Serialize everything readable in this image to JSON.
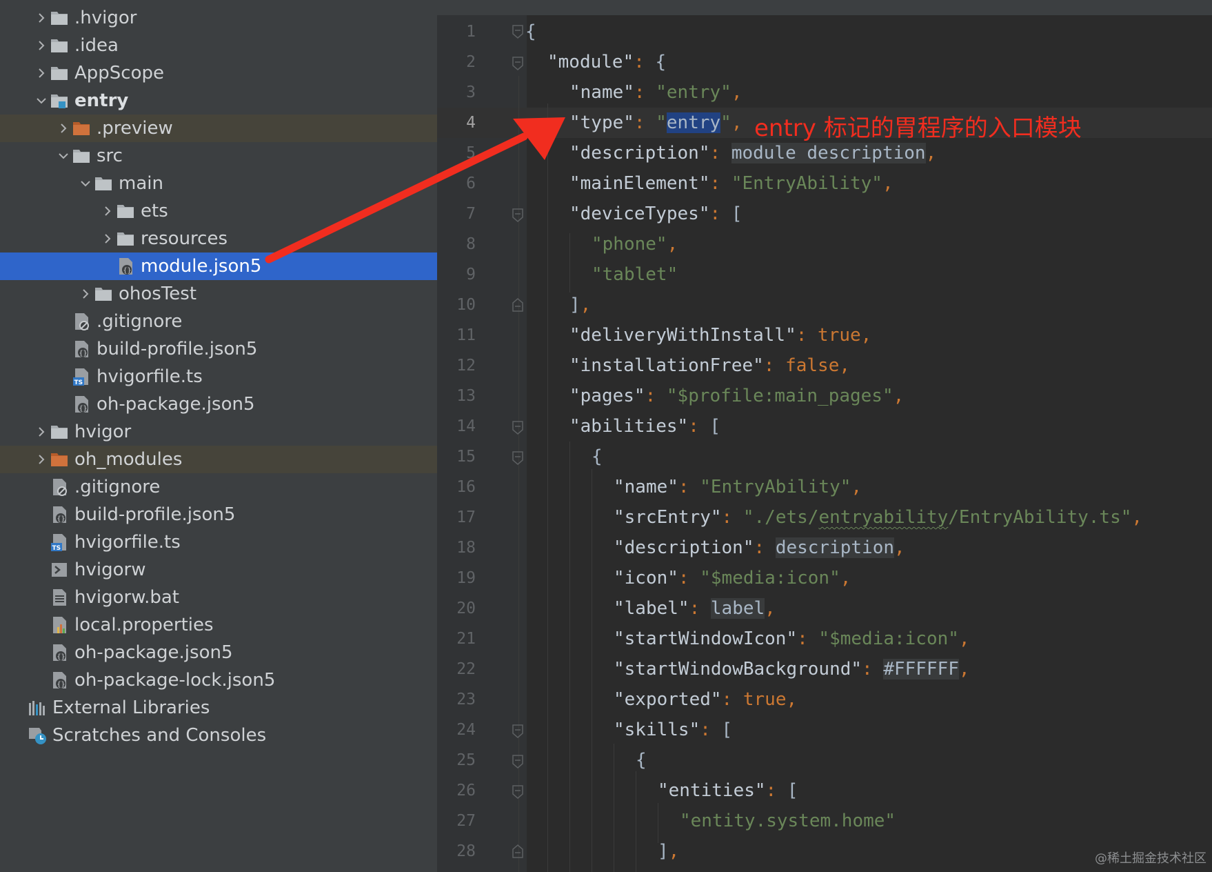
{
  "project_tree": {
    "items": [
      {
        "label": ".hvigor",
        "expanded": false,
        "icon": "folder-icon"
      },
      {
        "label": ".idea",
        "expanded": false,
        "icon": "folder-icon"
      },
      {
        "label": "AppScope",
        "expanded": false,
        "icon": "folder-icon"
      },
      {
        "label": "entry",
        "expanded": true,
        "icon": "module-folder-icon"
      },
      {
        "label": ".preview",
        "expanded": false,
        "icon": "excluded-folder-icon"
      },
      {
        "label": "src",
        "expanded": true,
        "icon": "folder-icon"
      },
      {
        "label": "main",
        "expanded": true,
        "icon": "folder-icon"
      },
      {
        "label": "ets",
        "expanded": false,
        "icon": "folder-icon"
      },
      {
        "label": "resources",
        "expanded": false,
        "icon": "folder-icon"
      },
      {
        "label": "module.json5",
        "icon": "json5-file-icon",
        "selected": true
      },
      {
        "label": "ohosTest",
        "expanded": false,
        "icon": "folder-icon"
      },
      {
        "label": ".gitignore",
        "icon": "gitignore-file-icon"
      },
      {
        "label": "build-profile.json5",
        "icon": "json5-file-icon"
      },
      {
        "label": "hvigorfile.ts",
        "icon": "typescript-file-icon"
      },
      {
        "label": "oh-package.json5",
        "icon": "json5-file-icon"
      },
      {
        "label": "hvigor",
        "expanded": false,
        "icon": "folder-icon"
      },
      {
        "label": "oh_modules",
        "expanded": false,
        "icon": "excluded-folder-icon"
      },
      {
        "label": ".gitignore",
        "icon": "gitignore-file-icon"
      },
      {
        "label": "build-profile.json5",
        "icon": "json5-file-icon"
      },
      {
        "label": "hvigorfile.ts",
        "icon": "typescript-file-icon"
      },
      {
        "label": "hvigorw",
        "icon": "shell-script-icon"
      },
      {
        "label": "hvigorw.bat",
        "icon": "text-file-icon"
      },
      {
        "label": "local.properties",
        "icon": "properties-file-icon"
      },
      {
        "label": "oh-package.json5",
        "icon": "json5-file-icon"
      },
      {
        "label": "oh-package-lock.json5",
        "icon": "json5-file-icon"
      },
      {
        "label": "External Libraries",
        "icon": "libraries-icon"
      },
      {
        "label": "Scratches and Consoles",
        "icon": "scratches-icon"
      }
    ]
  },
  "editor": {
    "current_line": 4,
    "line_numbers": [
      "1",
      "2",
      "3",
      "4",
      "5",
      "6",
      "7",
      "8",
      "9",
      "10",
      "11",
      "12",
      "13",
      "14",
      "15",
      "16",
      "17",
      "18",
      "19",
      "20",
      "21",
      "22",
      "23",
      "24",
      "25",
      "26",
      "27",
      "28"
    ],
    "lines": {
      "l1": {
        "brace": "{"
      },
      "l2": {
        "key": "\"module\"",
        "colon": ": ",
        "brace": "{"
      },
      "l3": {
        "key": "\"name\"",
        "colon": ": ",
        "value": "\"entry\"",
        "comma": ","
      },
      "l4": {
        "key": "\"type\"",
        "colon": ": ",
        "q1": "\"",
        "selected": "entry",
        "q2": "\"",
        "comma": ","
      },
      "l5": {
        "key": "\"description\"",
        "colon": ": ",
        "ref": "module description",
        "comma": ","
      },
      "l6": {
        "key": "\"mainElement\"",
        "colon": ": ",
        "value": "\"EntryAbility\"",
        "comma": ","
      },
      "l7": {
        "key": "\"deviceTypes\"",
        "colon": ": ",
        "bracket": "["
      },
      "l8": {
        "value": "\"phone\"",
        "comma": ","
      },
      "l9": {
        "value": "\"tablet\""
      },
      "l10": {
        "bracket": "]",
        "comma": ","
      },
      "l11": {
        "key": "\"deliveryWithInstall\"",
        "colon": ": ",
        "literal": "true",
        "comma": ","
      },
      "l12": {
        "key": "\"installationFree\"",
        "colon": ": ",
        "literal": "false",
        "comma": ","
      },
      "l13": {
        "key": "\"pages\"",
        "colon": ": ",
        "value": "\"$profile:main_pages\"",
        "comma": ","
      },
      "l14": {
        "key": "\"abilities\"",
        "colon": ": ",
        "bracket": "["
      },
      "l15": {
        "brace": "{"
      },
      "l16": {
        "key": "\"name\"",
        "colon": ": ",
        "value": "\"EntryAbility\"",
        "comma": ","
      },
      "l17": {
        "key": "\"srcEntry\"",
        "colon": ": ",
        "v1": "\"./ets/",
        "v2": "entryability",
        "v3": "/EntryAbility.ts\"",
        "comma": ","
      },
      "l18": {
        "key": "\"description\"",
        "colon": ": ",
        "ref": "description",
        "comma": ","
      },
      "l19": {
        "key": "\"icon\"",
        "colon": ": ",
        "value": "\"$media:icon\"",
        "comma": ","
      },
      "l20": {
        "key": "\"label\"",
        "colon": ": ",
        "ref": "label",
        "comma": ","
      },
      "l21": {
        "key": "\"startWindowIcon\"",
        "colon": ": ",
        "value": "\"$media:icon\"",
        "comma": ","
      },
      "l22": {
        "key": "\"startWindowBackground\"",
        "colon": ": ",
        "ref": "#FFFFFF",
        "comma": ","
      },
      "l23": {
        "key": "\"exported\"",
        "colon": ": ",
        "literal": "true",
        "comma": ","
      },
      "l24": {
        "key": "\"skills\"",
        "colon": ": ",
        "bracket": "["
      },
      "l25": {
        "brace": "{"
      },
      "l26": {
        "key": "\"entities\"",
        "colon": ": ",
        "bracket": "["
      },
      "l27": {
        "value": "\"entity.system.home\""
      },
      "l28": {
        "bracket": "]",
        "comma": ","
      }
    }
  },
  "annotation": {
    "text": "entry 标记的胃程序的入口模块",
    "color": "#f12d1f"
  },
  "watermark": "@稀土掘金技术社区",
  "colors": {
    "selection": "#2f65ca",
    "key": "#c3ccd6",
    "string": "#6a8759",
    "keyword": "#cc7832"
  }
}
